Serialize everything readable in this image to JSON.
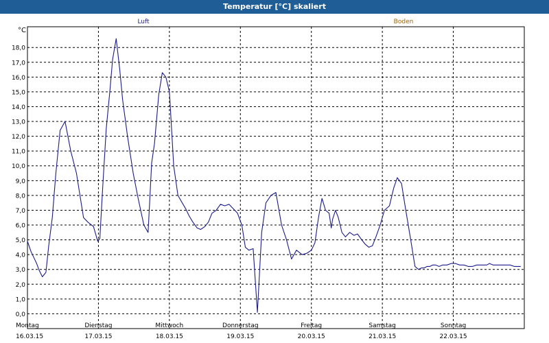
{
  "window": {
    "title": "Temperatur [°C] skaliert"
  },
  "chart_data": {
    "type": "line",
    "title": "Temperatur [°C] skaliert",
    "ylabel": "°C",
    "ylim": [
      -1,
      19.4
    ],
    "yticks": [
      0,
      1,
      2,
      3,
      4,
      5,
      6,
      7,
      8,
      9,
      10,
      11,
      12,
      13,
      14,
      15,
      16,
      17,
      18
    ],
    "ytick_labels": [
      "0,0",
      "1,0",
      "2,0",
      "3,0",
      "4,0",
      "5,0",
      "6,0",
      "7,0",
      "8,0",
      "9,0",
      "10,0",
      "11,0",
      "12,0",
      "13,0",
      "14,0",
      "15,0",
      "16,0",
      "17,0",
      "18,0"
    ],
    "xlim": [
      0,
      7
    ],
    "grid": true,
    "legend": [
      {
        "name": "Luft",
        "color": "#1a1a8c"
      },
      {
        "name": "Boden",
        "color": "#a0620a"
      }
    ],
    "day_labels": [
      {
        "day": "Montag",
        "date": "16.03.15"
      },
      {
        "day": "Dienstag",
        "date": "17.03.15"
      },
      {
        "day": "Mittwoch",
        "date": "18.03.15"
      },
      {
        "day": "Donnerstag",
        "date": "19.03.15"
      },
      {
        "day": "Freitag",
        "date": "20.03.15"
      },
      {
        "day": "Samstag",
        "date": "21.03.15"
      },
      {
        "day": "Sonntag",
        "date": "22.03.15"
      }
    ],
    "series": [
      {
        "name": "Luft",
        "color": "#1a1a8c",
        "x": [
          0.0,
          0.05,
          0.08,
          0.13,
          0.16,
          0.21,
          0.26,
          0.3,
          0.35,
          0.4,
          0.46,
          0.53,
          0.61,
          0.69,
          0.73,
          0.79,
          0.85,
          0.93,
          0.99,
          1.02,
          1.06,
          1.11,
          1.16,
          1.2,
          1.25,
          1.3,
          1.34,
          1.41,
          1.49,
          1.56,
          1.64,
          1.7,
          1.75,
          1.79,
          1.85,
          1.9,
          1.95,
          2.0,
          2.06,
          2.12,
          2.18,
          2.23,
          2.28,
          2.33,
          2.39,
          2.44,
          2.5,
          2.55,
          2.6,
          2.66,
          2.72,
          2.78,
          2.84,
          2.9,
          2.96,
          3.02,
          3.07,
          3.12,
          3.18,
          3.24,
          3.3,
          3.36,
          3.43,
          3.5,
          3.58,
          3.65,
          3.72,
          3.79,
          3.87,
          3.94,
          4.0,
          4.05,
          4.1,
          4.15,
          4.2,
          4.25,
          4.28,
          4.3,
          4.34,
          4.38,
          4.43,
          4.48,
          4.54,
          4.6,
          4.65,
          4.71,
          4.76,
          4.81,
          4.86,
          4.91,
          4.97,
          5.03,
          5.1,
          5.16,
          5.21,
          5.27,
          5.33,
          5.4,
          5.46,
          5.51,
          5.55,
          5.59,
          5.63,
          5.67,
          5.71,
          5.75,
          5.8,
          5.85,
          5.91,
          5.97,
          6.03,
          6.09,
          6.15,
          6.21,
          6.27,
          6.33,
          6.38,
          6.43,
          6.47,
          6.51,
          6.56,
          6.6,
          6.64,
          6.68,
          6.74,
          6.8,
          6.86,
          6.9,
          6.95
        ],
        "y": [
          4.9,
          4.2,
          3.9,
          3.4,
          3.0,
          2.5,
          2.8,
          4.6,
          6.5,
          9.5,
          12.4,
          13.0,
          11.0,
          9.5,
          8.3,
          6.5,
          6.2,
          5.9,
          4.9,
          5.1,
          8.5,
          12.5,
          15.0,
          17.2,
          18.6,
          16.5,
          14.5,
          12.0,
          9.5,
          7.8,
          6.0,
          5.5,
          10.2,
          11.5,
          14.8,
          16.3,
          16.0,
          15.0,
          10.0,
          8.0,
          7.5,
          7.1,
          6.6,
          6.2,
          5.8,
          5.7,
          5.9,
          6.2,
          6.8,
          7.0,
          7.4,
          7.3,
          7.4,
          7.1,
          6.8,
          6.0,
          4.5,
          4.3,
          4.4,
          0.1,
          5.5,
          7.5,
          8.0,
          8.2,
          6.0,
          5.0,
          3.7,
          4.3,
          4.0,
          4.1,
          4.3,
          4.8,
          6.5,
          7.8,
          7.0,
          6.8,
          5.8,
          6.4,
          7.0,
          6.5,
          5.5,
          5.2,
          5.5,
          5.3,
          5.4,
          5.0,
          4.7,
          4.5,
          4.6,
          5.2,
          6.0,
          7.0,
          7.3,
          8.5,
          9.2,
          8.8,
          7.0,
          5.0,
          3.2,
          3.0,
          3.1,
          3.1,
          3.2,
          3.2,
          3.3,
          3.3,
          3.2,
          3.3,
          3.3,
          3.4,
          3.4,
          3.3,
          3.3,
          3.2,
          3.2,
          3.3,
          3.3,
          3.3,
          3.3,
          3.4,
          3.3,
          3.3,
          3.3,
          3.3,
          3.3,
          3.3,
          3.2,
          3.2,
          3.2
        ]
      }
    ]
  }
}
